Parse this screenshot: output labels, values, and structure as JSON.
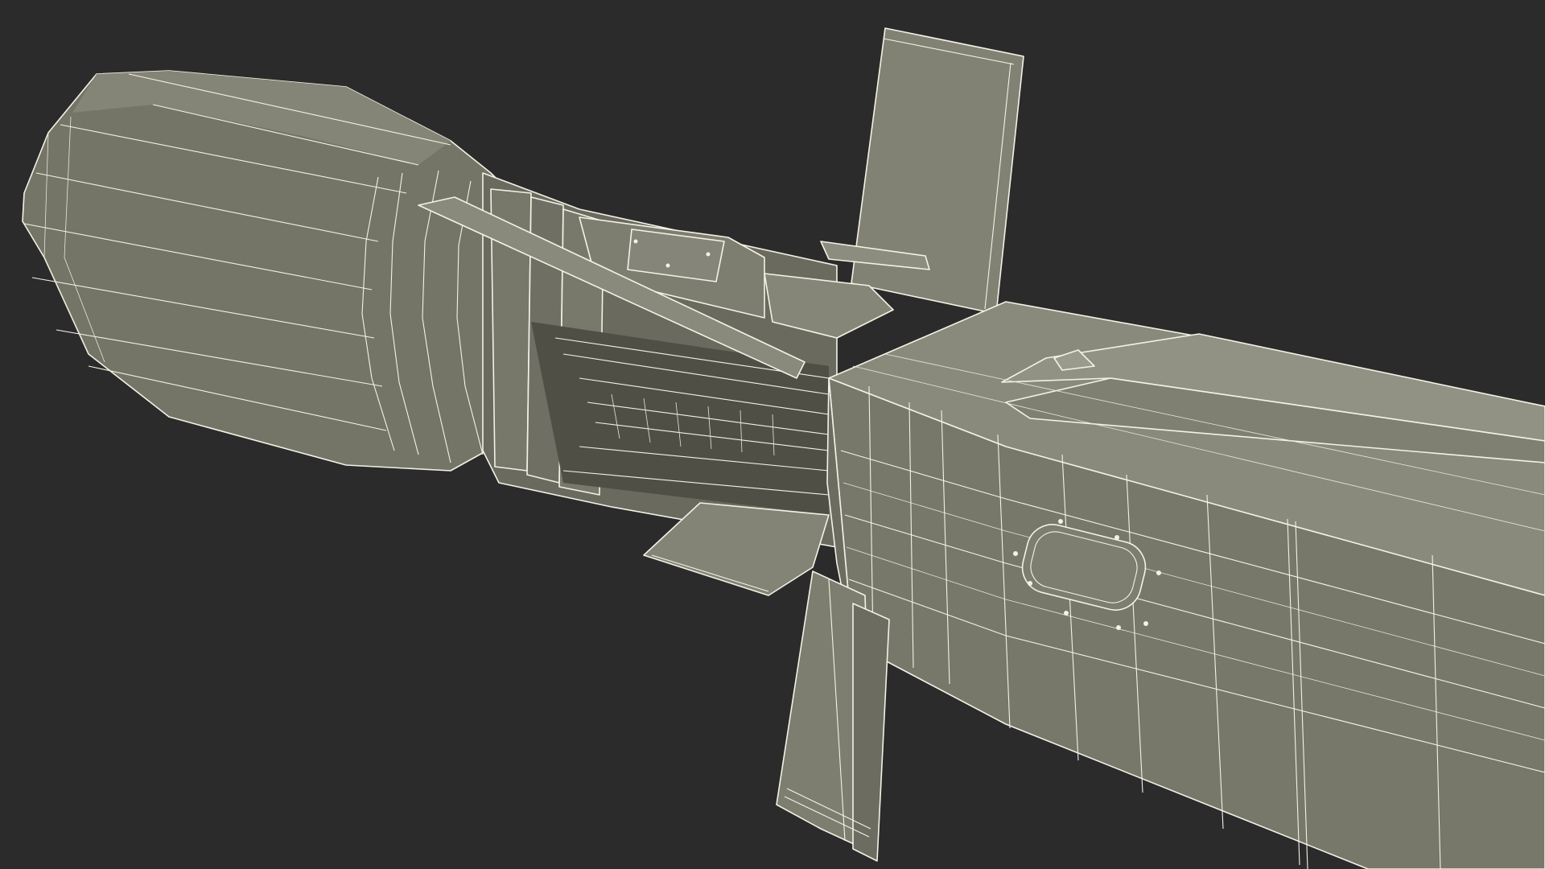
{
  "scene": {
    "background_color": "#2b2b2b",
    "model_color": "#7a7a6c",
    "model_shadow_color": "#5e5e53",
    "model_highlight_color": "#8a8a7c",
    "wire_color": "#f4f2e6",
    "render_style": "wireframe-on-shaded"
  }
}
